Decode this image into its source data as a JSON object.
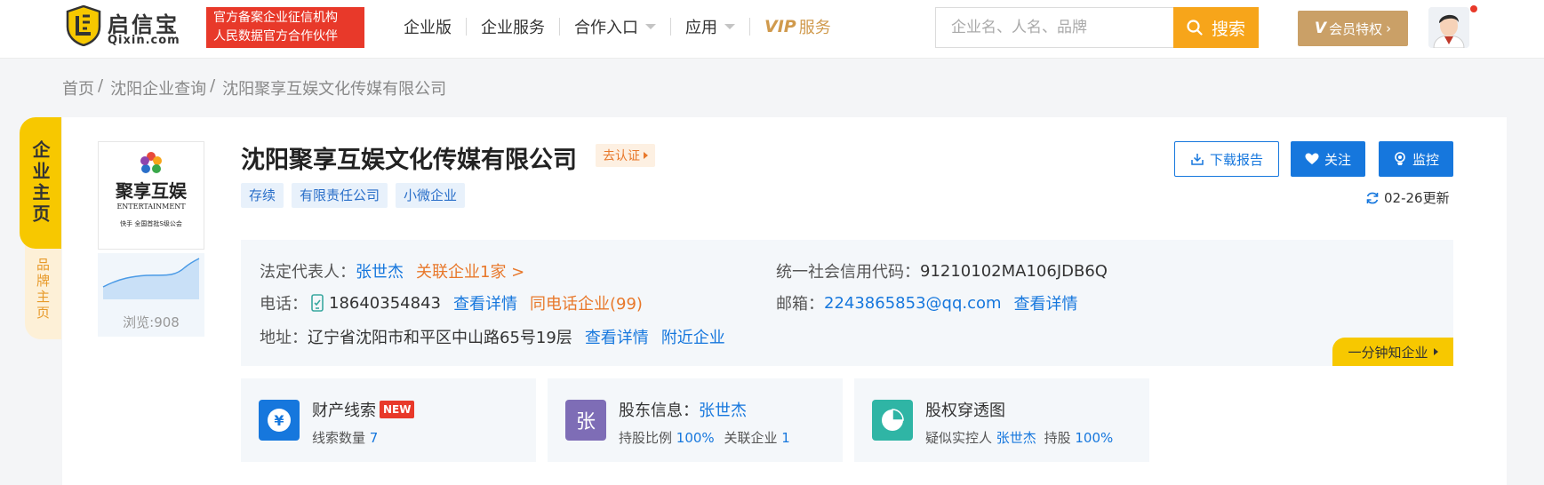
{
  "header": {
    "logo": {
      "name": "启信宝",
      "domain": "Qixin.com"
    },
    "badge": {
      "line1": "官方备案企业征信机构",
      "line2": "人民数据官方合作伙伴"
    },
    "nav": [
      {
        "label": "企业版"
      },
      {
        "label": "企业服务"
      },
      {
        "label": "合作入口"
      },
      {
        "label": "应用"
      }
    ],
    "vip": {
      "mark": "VIP",
      "label": "服务"
    },
    "search": {
      "placeholder": "企业名、人名、品牌",
      "button_label": "搜索"
    },
    "member_button": {
      "mark": "V",
      "label": "会员特权"
    }
  },
  "breadcrumb": [
    "首页",
    "沈阳企业查询",
    "沈阳聚享互娱文化传媒有限公司"
  ],
  "side_tabs": {
    "main": "企业主页",
    "brand": "品牌主页"
  },
  "company": {
    "logo_text": {
      "cn": "聚享互娱",
      "en": "ENTERTAINMENT",
      "tagline": "快手 全国首批S级公会"
    },
    "views": "浏览:908",
    "name": "沈阳聚享互娱文化传媒有限公司",
    "cert_label": "去认证",
    "tags": [
      "存续",
      "有限责任公司",
      "小微企业"
    ],
    "update": "02-26更新"
  },
  "actions": {
    "download": "下载报告",
    "follow": "关注",
    "monitor": "监控"
  },
  "info": {
    "legal_rep": {
      "label": "法定代表人：",
      "value": "张世杰",
      "related": "关联企业1家 >"
    },
    "credit_code": {
      "label": "统一社会信用代码：",
      "value": "91210102MA106JDB6Q"
    },
    "phone": {
      "label": "电话：",
      "value": "18640354843",
      "detail": "查看详情",
      "same_phone": "同电话企业(99)"
    },
    "email": {
      "label": "邮箱：",
      "value": "2243865853@qq.com",
      "detail": "查看详情"
    },
    "address": {
      "label": "地址：",
      "value": "辽宁省沈阳市和平区中山路65号19层",
      "detail": "查看详情",
      "nearby": "附近企业"
    },
    "minute_tag": "一分钟知企业"
  },
  "features": [
    {
      "title": "财产线索",
      "badge": "NEW",
      "sub_label": "线索数量",
      "sub_value": "7",
      "icon": "¥"
    },
    {
      "title": "股东信息：",
      "title_link": "张世杰",
      "icon": "张",
      "sub1_label": "持股比例",
      "sub1_value": "100%",
      "sub2_label": "关联企业",
      "sub2_value": "1"
    },
    {
      "title": "股权穿透图",
      "sub_label": "疑似实控人",
      "sub_link": "张世杰",
      "sub2_label": "持股",
      "sub2_value": "100%"
    }
  ],
  "colors": {
    "accent": "#1677dd",
    "brand_yellow": "#f7c800",
    "search_orange": "#f7a51a",
    "vip_gold": "#caa067",
    "badge_red": "#e8392a"
  }
}
